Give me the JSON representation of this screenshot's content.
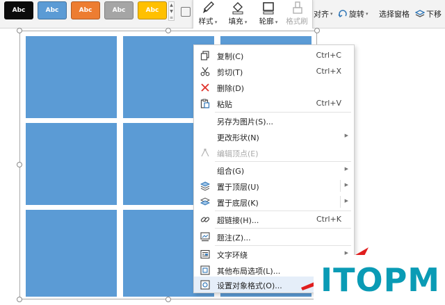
{
  "ribbon": {
    "styles": [
      {
        "label": "Abc",
        "bg": "#0b0b0b",
        "fg": "#ffffff",
        "border": "#0b0b0b"
      },
      {
        "label": "Abc",
        "bg": "#5b9bd5",
        "fg": "#ffffff",
        "border": "#41719c"
      },
      {
        "label": "Abc",
        "bg": "#ed7d31",
        "fg": "#ffffff",
        "border": "#ae5a21"
      },
      {
        "label": "Abc",
        "bg": "#a5a5a5",
        "fg": "#ffffff",
        "border": "#7f7f7f"
      },
      {
        "label": "Abc",
        "bg": "#ffc000",
        "fg": "#ffffff",
        "border": "#bc8c00"
      }
    ],
    "style_label": "样式",
    "fill_label": "填充",
    "outline_label": "轮廓",
    "format_painter_label": "格式刷",
    "align_label": "对齐",
    "rotate_label": "旋转",
    "selection_pane_label": "选择窗格",
    "move_down_label": "下移"
  },
  "context_menu": {
    "items": [
      {
        "label": "复制(C)",
        "shortcut": "Ctrl+C",
        "icon": "copy-icon"
      },
      {
        "label": "剪切(T)",
        "shortcut": "Ctrl+X",
        "icon": "scissors-icon"
      },
      {
        "label": "删除(D)",
        "shortcut": "",
        "icon": "delete-x-icon"
      },
      {
        "label": "粘贴",
        "shortcut": "Ctrl+V",
        "icon": "paste-icon"
      },
      {
        "label": "另存为图片(S)...",
        "shortcut": "",
        "icon": ""
      },
      {
        "label": "更改形状(N)",
        "shortcut": "",
        "icon": ""
      },
      {
        "label": "编辑顶点(E)",
        "shortcut": "",
        "icon": "edit-points-icon"
      },
      {
        "label": "组合(G)",
        "shortcut": "",
        "icon": ""
      },
      {
        "label": "置于顶层(U)",
        "shortcut": "",
        "icon": "bring-to-front-icon"
      },
      {
        "label": "置于底层(K)",
        "shortcut": "",
        "icon": "send-to-back-icon"
      },
      {
        "label": "超链接(H)...",
        "shortcut": "Ctrl+K",
        "icon": "hyperlink-icon"
      },
      {
        "label": "题注(Z)...",
        "shortcut": "",
        "icon": "caption-icon"
      },
      {
        "label": "文字环绕",
        "shortcut": "",
        "icon": "text-wrap-icon"
      },
      {
        "label": "其他布局选项(L)...",
        "shortcut": "",
        "icon": "layout-options-icon"
      },
      {
        "label": "设置对象格式(O)...",
        "shortcut": "",
        "icon": "format-object-icon"
      }
    ]
  },
  "colors": {
    "tile": "#5b9bd5",
    "delete_red": "#e0312a",
    "watermark": "#0a9bb5",
    "arrow_red": "#e01e1e",
    "highlight": "#e5eef9"
  },
  "watermark": {
    "text": "ITOPM"
  }
}
